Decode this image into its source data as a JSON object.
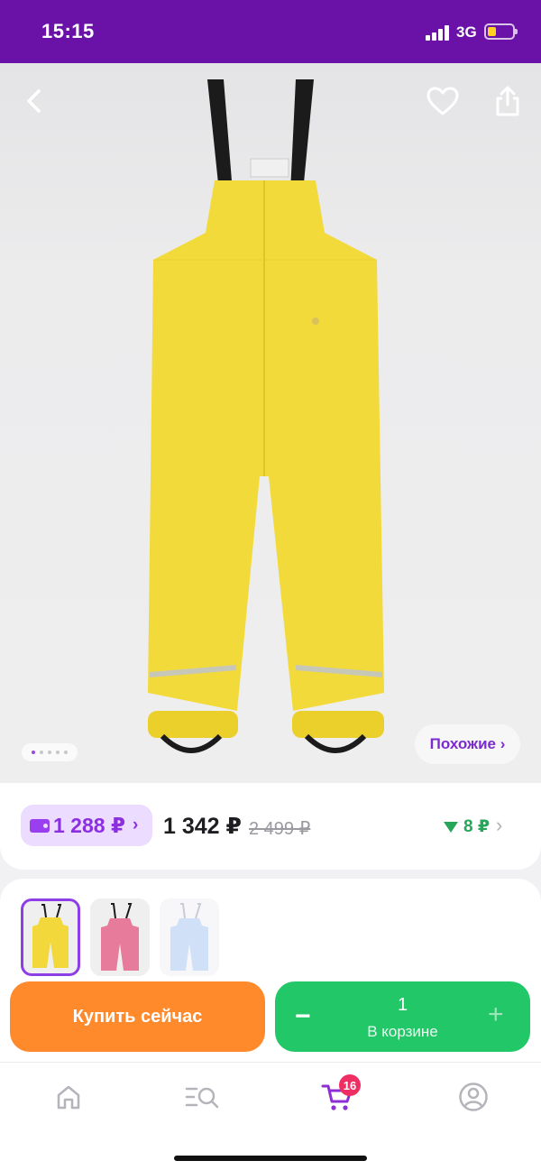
{
  "status_bar": {
    "time": "15:15",
    "network": "3G",
    "icons": [
      "signal-icon",
      "battery-icon"
    ],
    "battery_fill": 0.25,
    "battery_color": "#ffd21f"
  },
  "header": {
    "icons": [
      "back-icon",
      "heart-icon",
      "share-icon"
    ]
  },
  "gallery": {
    "image_count": 5,
    "active_image_index": 0,
    "similar_label": "Похожие ›"
  },
  "price": {
    "wallet_price": "1 288 ₽",
    "wallet_chevron": "›",
    "current_price": "1 342 ₽",
    "old_price": "2 499 ₽",
    "bonus": "8 ₽",
    "bonus_chevron": "›",
    "colors": {
      "wallet": "#8b2fe0",
      "bonus": "#26a65b"
    }
  },
  "variants": {
    "items": [
      {
        "color": "yellow",
        "hex": "#f2d83a",
        "selected": true
      },
      {
        "color": "pink",
        "hex": "#e77b9c",
        "selected": false
      },
      {
        "color": "light-blue",
        "hex": "#cfe0f7",
        "selected": false
      }
    ]
  },
  "actions": {
    "buy_now_label": "Купить сейчас",
    "cart_quantity": "1",
    "cart_label": "В корзине",
    "minus_label": "−",
    "plus_label": "+",
    "colors": {
      "buy": "#ff8a2b",
      "cart": "#22c768"
    }
  },
  "bottom_nav": {
    "tabs": [
      "home-icon",
      "catalog-search-icon",
      "cart-icon",
      "profile-icon"
    ],
    "active_tab": "cart-icon",
    "cart_badge": "16",
    "accent": "#8e2fd6"
  }
}
